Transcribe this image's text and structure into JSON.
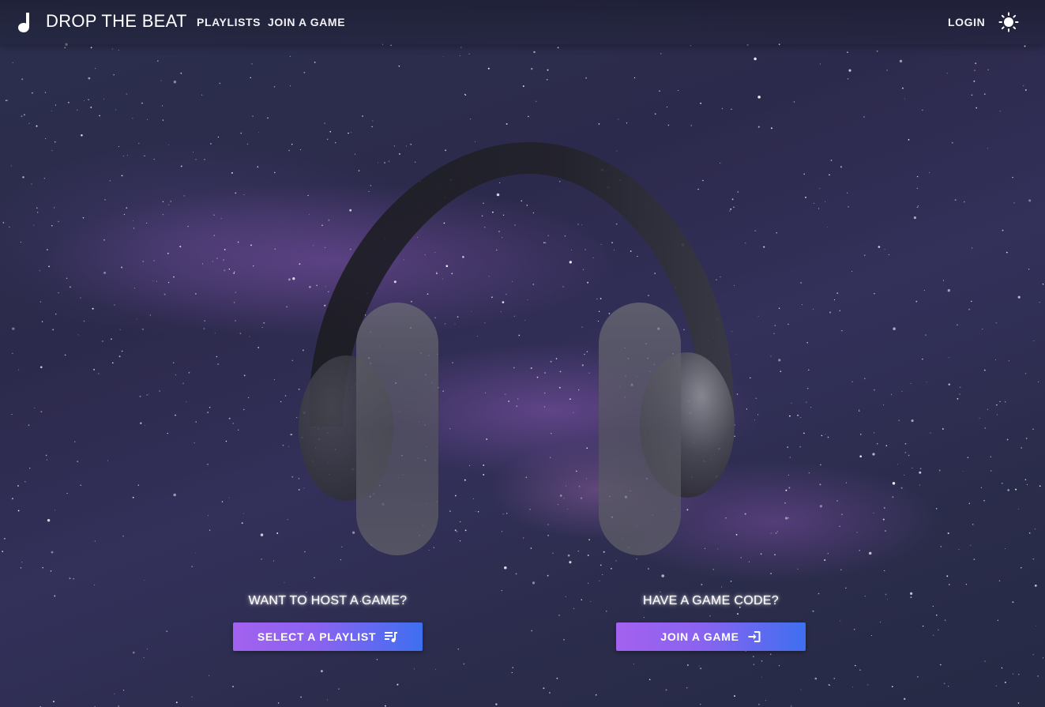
{
  "header": {
    "brand_icon": "music-note-icon",
    "brand_title": "DROP THE BEAT",
    "nav": [
      {
        "label": "PLAYLISTS"
      },
      {
        "label": "JOIN A GAME"
      }
    ],
    "login_label": "LOGIN",
    "theme_icon": "sun-icon"
  },
  "hero": {
    "illustration": "headphones-icon"
  },
  "host": {
    "question": "WANT TO HOST A GAME?",
    "button_label": "SELECT A PLAYLIST",
    "button_icon": "playlist-icon"
  },
  "join": {
    "question": "HAVE A GAME CODE?",
    "button_label": "JOIN A GAME",
    "button_icon": "login-icon"
  },
  "colors": {
    "button_gradient_start": "#a262ef",
    "button_gradient_end": "#3e6ff0",
    "background": "#2c2a4c",
    "text": "#ffffff"
  }
}
